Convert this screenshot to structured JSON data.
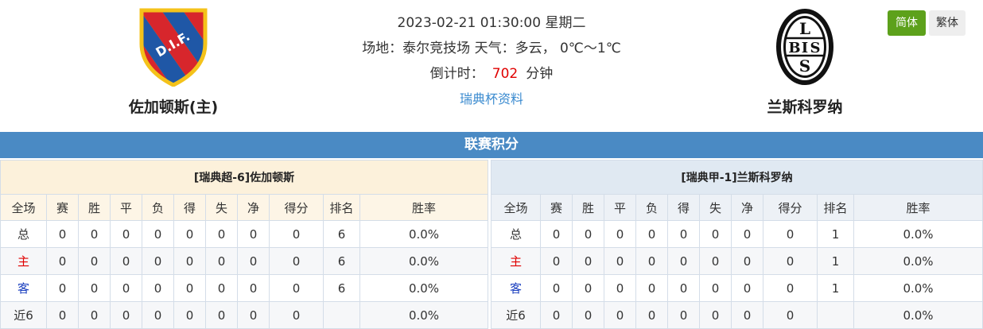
{
  "match": {
    "datetime": "2023-02-21 01:30:00 星期二",
    "venue_weather": "场地：泰尔竞技场 天气：多云， 0℃～1℃",
    "countdown_label": "倒计时：",
    "countdown_value": "702",
    "countdown_unit": "分钟",
    "cup_link": "瑞典杯资料"
  },
  "home_team": {
    "name": "佐加顿斯(主)",
    "logo_text": "D.I.F.",
    "colors": {
      "stripe_blue": "#1f57a6",
      "stripe_red": "#d7262c",
      "yellow": "#f4c21a"
    }
  },
  "away_team": {
    "name": "兰斯科罗纳",
    "logo_letters": [
      "L",
      "B",
      "I",
      "S"
    ]
  },
  "lang": {
    "simplified": "简体",
    "traditional": "繁体"
  },
  "section_title": "联赛积分",
  "standings": {
    "columns": [
      "全场",
      "赛",
      "胜",
      "平",
      "负",
      "得",
      "失",
      "净",
      "得分",
      "排名",
      "胜率"
    ],
    "left": {
      "title": "[瑞典超-6]佐加顿斯",
      "rows": [
        {
          "label": "总",
          "type": "total",
          "cells": [
            "0",
            "0",
            "0",
            "0",
            "0",
            "0",
            "0",
            "0",
            "6",
            "0.0%"
          ]
        },
        {
          "label": "主",
          "type": "home",
          "cells": [
            "0",
            "0",
            "0",
            "0",
            "0",
            "0",
            "0",
            "0",
            "6",
            "0.0%"
          ]
        },
        {
          "label": "客",
          "type": "away",
          "cells": [
            "0",
            "0",
            "0",
            "0",
            "0",
            "0",
            "0",
            "0",
            "6",
            "0.0%"
          ]
        },
        {
          "label": "近6",
          "type": "recent",
          "cells": [
            "0",
            "0",
            "0",
            "0",
            "0",
            "0",
            "0",
            "0",
            "",
            "0.0%"
          ]
        }
      ]
    },
    "right": {
      "title": "[瑞典甲-1]兰斯科罗纳",
      "rows": [
        {
          "label": "总",
          "type": "total",
          "cells": [
            "0",
            "0",
            "0",
            "0",
            "0",
            "0",
            "0",
            "0",
            "1",
            "0.0%"
          ]
        },
        {
          "label": "主",
          "type": "home",
          "cells": [
            "0",
            "0",
            "0",
            "0",
            "0",
            "0",
            "0",
            "0",
            "1",
            "0.0%"
          ]
        },
        {
          "label": "客",
          "type": "away",
          "cells": [
            "0",
            "0",
            "0",
            "0",
            "0",
            "0",
            "0",
            "0",
            "1",
            "0.0%"
          ]
        },
        {
          "label": "近6",
          "type": "recent",
          "cells": [
            "0",
            "0",
            "0",
            "0",
            "0",
            "0",
            "0",
            "0",
            "",
            "0.0%"
          ]
        }
      ]
    }
  }
}
